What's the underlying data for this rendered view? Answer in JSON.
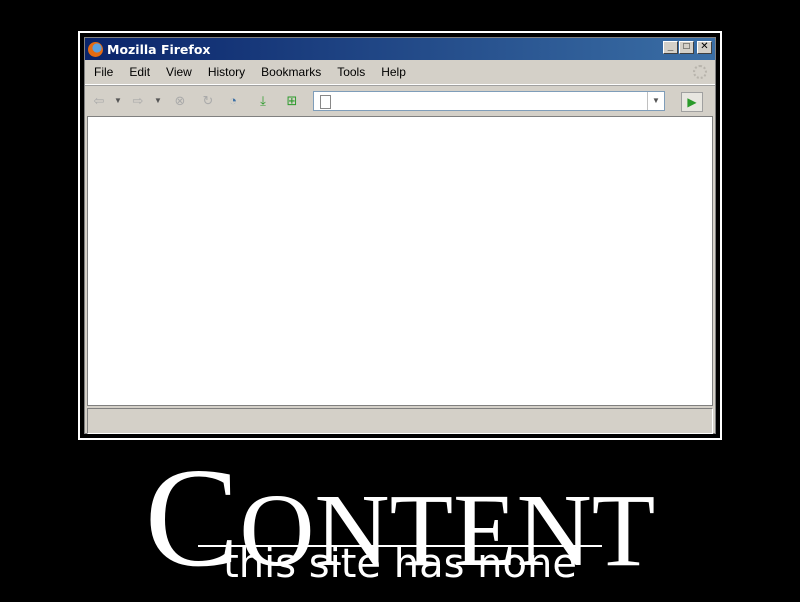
{
  "window": {
    "title": "Mozilla Firefox",
    "minimize_glyph": "_",
    "maximize_glyph": "□",
    "close_glyph": "✕"
  },
  "menubar": {
    "items": [
      "File",
      "Edit",
      "View",
      "History",
      "Bookmarks",
      "Tools",
      "Help"
    ]
  },
  "toolbar": {
    "back_glyph": "⇦",
    "forward_glyph": "⇨",
    "dropdown_glyph": "▼",
    "stop_glyph": "⊗",
    "reload_glyph": "↻",
    "history_glyph": "◔",
    "download_glyph": "⤓",
    "newtab_glyph": "⊞",
    "go_glyph": "▶"
  },
  "urlbar": {
    "value": "",
    "dropdown_glyph": "▼"
  },
  "caption": {
    "title_first_letter": "C",
    "title_rest": "ONTENT",
    "title_last_letter": "T",
    "subtitle": "this site has none"
  }
}
